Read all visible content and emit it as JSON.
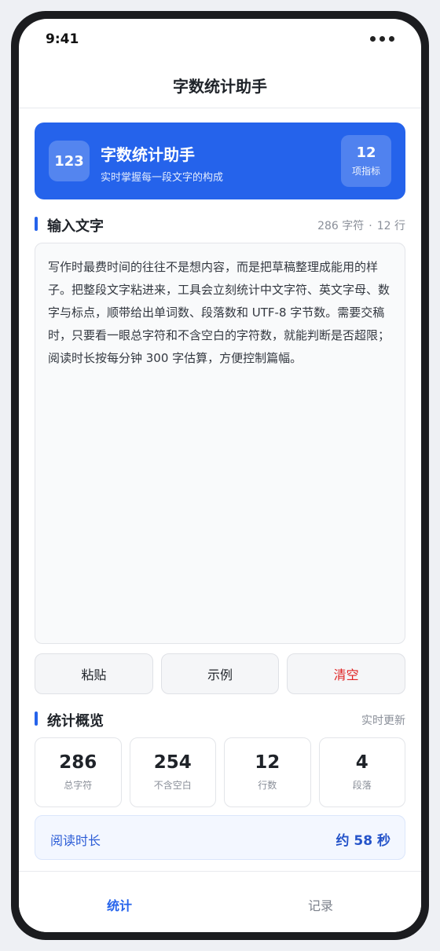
{
  "status": {
    "time": "9:41",
    "menu_icon": "more-dots-icon"
  },
  "nav": {
    "title": "字数统计助手"
  },
  "hero": {
    "logo_text": "123",
    "title": "字数统计助手",
    "subtitle": "实时掌握每一段文字的构成",
    "metric_value": "12",
    "metric_label": "项指标"
  },
  "input_section": {
    "title": "输入文字",
    "char_count": "286 字符",
    "separator": "·",
    "line_count": "12 行",
    "text": "写作时最费时间的往往不是想内容，而是把草稿整理成能用的样子。把整段文字粘进来，工具会立刻统计中文字符、英文字母、数字与标点，顺带给出单词数、段落数和 UTF-8 字节数。需要交稿时，只要看一眼总字符和不含空白的字符数，就能判断是否超限；阅读时长按每分钟 300 字估算，方便控制篇幅。"
  },
  "actions": {
    "paste": "粘贴",
    "example": "示例",
    "clear": "清空"
  },
  "stats_section": {
    "title": "统计概览",
    "meta": "实时更新",
    "cards": [
      {
        "value": "286",
        "label": "总字符"
      },
      {
        "value": "254",
        "label": "不含空白"
      },
      {
        "value": "12",
        "label": "行数"
      },
      {
        "value": "4",
        "label": "段落"
      }
    ]
  },
  "reading": {
    "label": "阅读时长",
    "value": "约 58 秒"
  },
  "tabs": {
    "stats": "统计",
    "records": "记录"
  },
  "colors": {
    "accent": "#2563eb",
    "danger": "#e02424",
    "background": "#eef0f4"
  }
}
